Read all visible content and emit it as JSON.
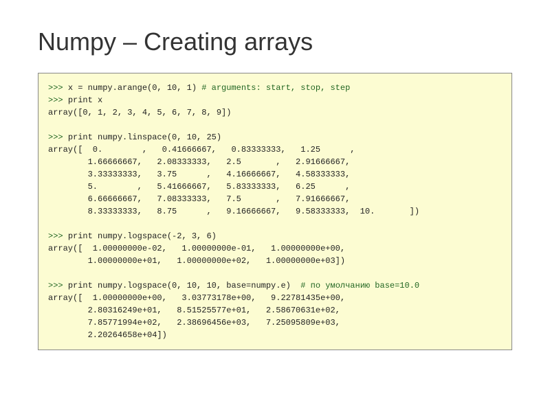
{
  "title": "Numpy – Creating arrays",
  "code": {
    "l1_prompt": ">>> ",
    "l1_code": "x = numpy.arange(0, 10, 1) ",
    "l1_comment": "# arguments: start, stop, step",
    "l2_prompt": ">>> ",
    "l2_code": "print x",
    "l3": "array([0, 1, 2, 3, 4, 5, 6, 7, 8, 9])",
    "l5_prompt": ">>> ",
    "l5_code": "print numpy.linspace(0, 10, 25)",
    "l6": "array([  0.        ,   0.41666667,   0.83333333,   1.25      ,",
    "l7": "        1.66666667,   2.08333333,   2.5       ,   2.91666667,",
    "l8": "        3.33333333,   3.75      ,   4.16666667,   4.58333333,",
    "l9": "        5.        ,   5.41666667,   5.83333333,   6.25      ,",
    "l10": "        6.66666667,   7.08333333,   7.5       ,   7.91666667,",
    "l11": "        8.33333333,   8.75      ,   9.16666667,   9.58333333,  10.       ])",
    "l13_prompt": ">>> ",
    "l13_code": "print numpy.logspace(-2, 3, 6)",
    "l14": "array([  1.00000000e-02,   1.00000000e-01,   1.00000000e+00,",
    "l15": "        1.00000000e+01,   1.00000000e+02,   1.00000000e+03])",
    "l17_prompt": ">>> ",
    "l17_code": "print numpy.logspace(0, 10, 10, base=numpy.e)  ",
    "l17_comment": "# по умолчанию base=10.0",
    "l18": "array([  1.00000000e+00,   3.03773178e+00,   9.22781435e+00,",
    "l19": "        2.80316249e+01,   8.51525577e+01,   2.58670631e+02,",
    "l20": "        7.85771994e+02,   2.38696456e+03,   7.25095809e+03,",
    "l21": "        2.20264658e+04])"
  }
}
